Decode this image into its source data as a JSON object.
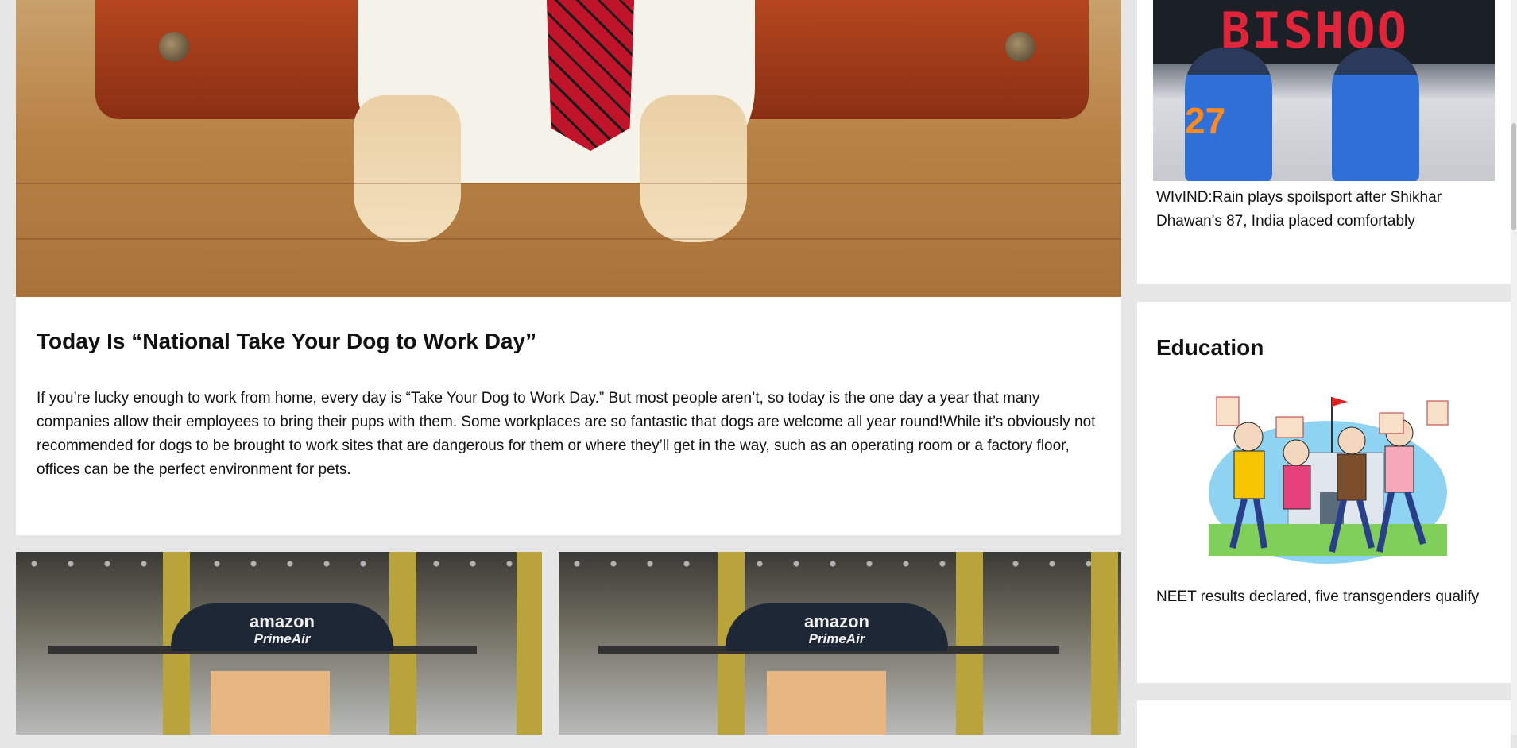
{
  "featured_article": {
    "title": "Today Is “National Take Your Dog to Work Day”",
    "body": "If you’re lucky enough to work from home, every day is “Take Your Dog to Work Day.” But most people aren’t, so today is the one day a year that many companies allow their employees to bring their pups with them. Some workplaces are so fantastic that dogs are welcome all year round!While it’s obviously not recommended for dogs to be brought to work sites that are dangerous for them or where they’ll get in the way, such as an operating room or a factory floor, offices can be the perfect environment for pets."
  },
  "drone_cards": [
    {
      "brand_top": "amazon",
      "brand_bottom": "PrimeAir"
    },
    {
      "brand_top": "amazon",
      "brand_bottom": "PrimeAir"
    }
  ],
  "sidebar": {
    "sports_item": {
      "board_text": "BISHOO",
      "jersey_number": "27",
      "caption": "WIvIND:Rain plays spoilsport after Shikhar Dhawan's 87, India placed comfortably"
    },
    "education": {
      "heading": "Education",
      "caption": "NEET results declared, five transgenders qualify"
    }
  }
}
